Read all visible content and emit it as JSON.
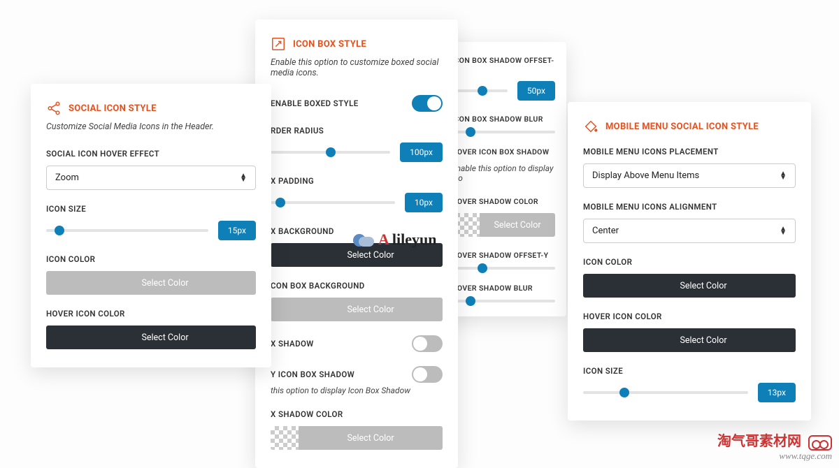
{
  "panel1": {
    "title": "SOCIAL ICON STYLE",
    "subtitle": "Customize Social Media Icons in the Header.",
    "hover_label": "SOCIAL ICON HOVER EFFECT",
    "hover_value": "Zoom",
    "size_label": "ICON SIZE",
    "size_value": "15px",
    "color_label": "ICON COLOR",
    "hover_color_label": "HOVER ICON COLOR",
    "select_color": "Select Color"
  },
  "panel2": {
    "title": "ICON BOX STYLE",
    "subtitle": "Enable this option to customize boxed social media icons.",
    "enable_label": "ENABLE BOXED STYLE",
    "radius_label": "RDER RADIUS",
    "radius_value": "100px",
    "padding_label": "X PADDING",
    "padding_value": "10px",
    "bg_label": "X BACKGROUND",
    "hover_bg_label": "CON BOX BACKGROUND",
    "shadow_label": "X SHADOW",
    "y_shadow_label": "Y ICON BOX SHADOW",
    "y_shadow_sub": "this option to display Icon Box Shadow",
    "shadow_color_label": "X SHADOW COLOR",
    "select_color": "Select Color"
  },
  "panel3": {
    "offsety_label": "ICON BOX SHADOW OFFSET-Y",
    "offsety_value": "50px",
    "blur_label": "ICON BOX SHADOW BLUR",
    "hover_shadow_label": "HOVER ICON BOX SHADOW",
    "hover_shadow_sub": "Enable this option to display Ico",
    "hover_color_label": "HOVER SHADOW COLOR",
    "hover_offsety_label": "HOVER SHADOW OFFSET-Y",
    "hover_blur_label": "HOVER SHADOW BLUR",
    "select_color": "Select Color"
  },
  "panel4": {
    "title": "MOBILE MENU SOCIAL ICON STYLE",
    "placement_label": "MOBILE MENU ICONS PLACEMENT",
    "placement_value": "Display Above Menu Items",
    "align_label": "MOBILE MENU ICONS ALIGNMENT",
    "align_value": "Center",
    "color_label": "ICON COLOR",
    "hover_color_label": "HOVER ICON COLOR",
    "size_label": "ICON SIZE",
    "size_value": "13px",
    "select_color": "Select Color"
  },
  "watermark": {
    "center": "lileyun",
    "br_cn": "淘气哥素材网",
    "br_url": "www.tqge.com"
  }
}
